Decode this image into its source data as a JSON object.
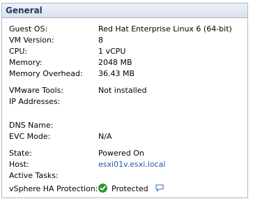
{
  "panel": {
    "title": "General"
  },
  "rows": {
    "guest_os": {
      "label": "Guest OS:",
      "value": "Red Hat Enterprise Linux 6 (64-bit)"
    },
    "vm_version": {
      "label": "VM Version:",
      "value": "8"
    },
    "cpu": {
      "label": "CPU:",
      "value": "1 vCPU"
    },
    "memory": {
      "label": "Memory:",
      "value": "2048 MB"
    },
    "memory_overhead": {
      "label": "Memory Overhead:",
      "value": "36.43 MB"
    },
    "vmware_tools": {
      "label": "VMware Tools:",
      "value": "Not installed"
    },
    "ip_addresses": {
      "label": "IP Addresses:",
      "value": ""
    },
    "dns_name": {
      "label": "DNS Name:",
      "value": ""
    },
    "evc_mode": {
      "label": "EVC Mode:",
      "value": "N/A"
    },
    "state": {
      "label": "State:",
      "value": "Powered On"
    },
    "host": {
      "label": "Host:",
      "value": "esxi01v.esxi.local"
    },
    "active_tasks": {
      "label": "Active Tasks:",
      "value": ""
    },
    "ha_protection": {
      "label": "vSphere HA Protection:",
      "value": "Protected"
    }
  },
  "icons": {
    "ha_status": "green-check-icon",
    "ha_details": "speech-bubble-icon"
  },
  "colors": {
    "header_text": "#1f3b63",
    "link": "#1d57a9",
    "status_ok": "#2e9a2e"
  }
}
